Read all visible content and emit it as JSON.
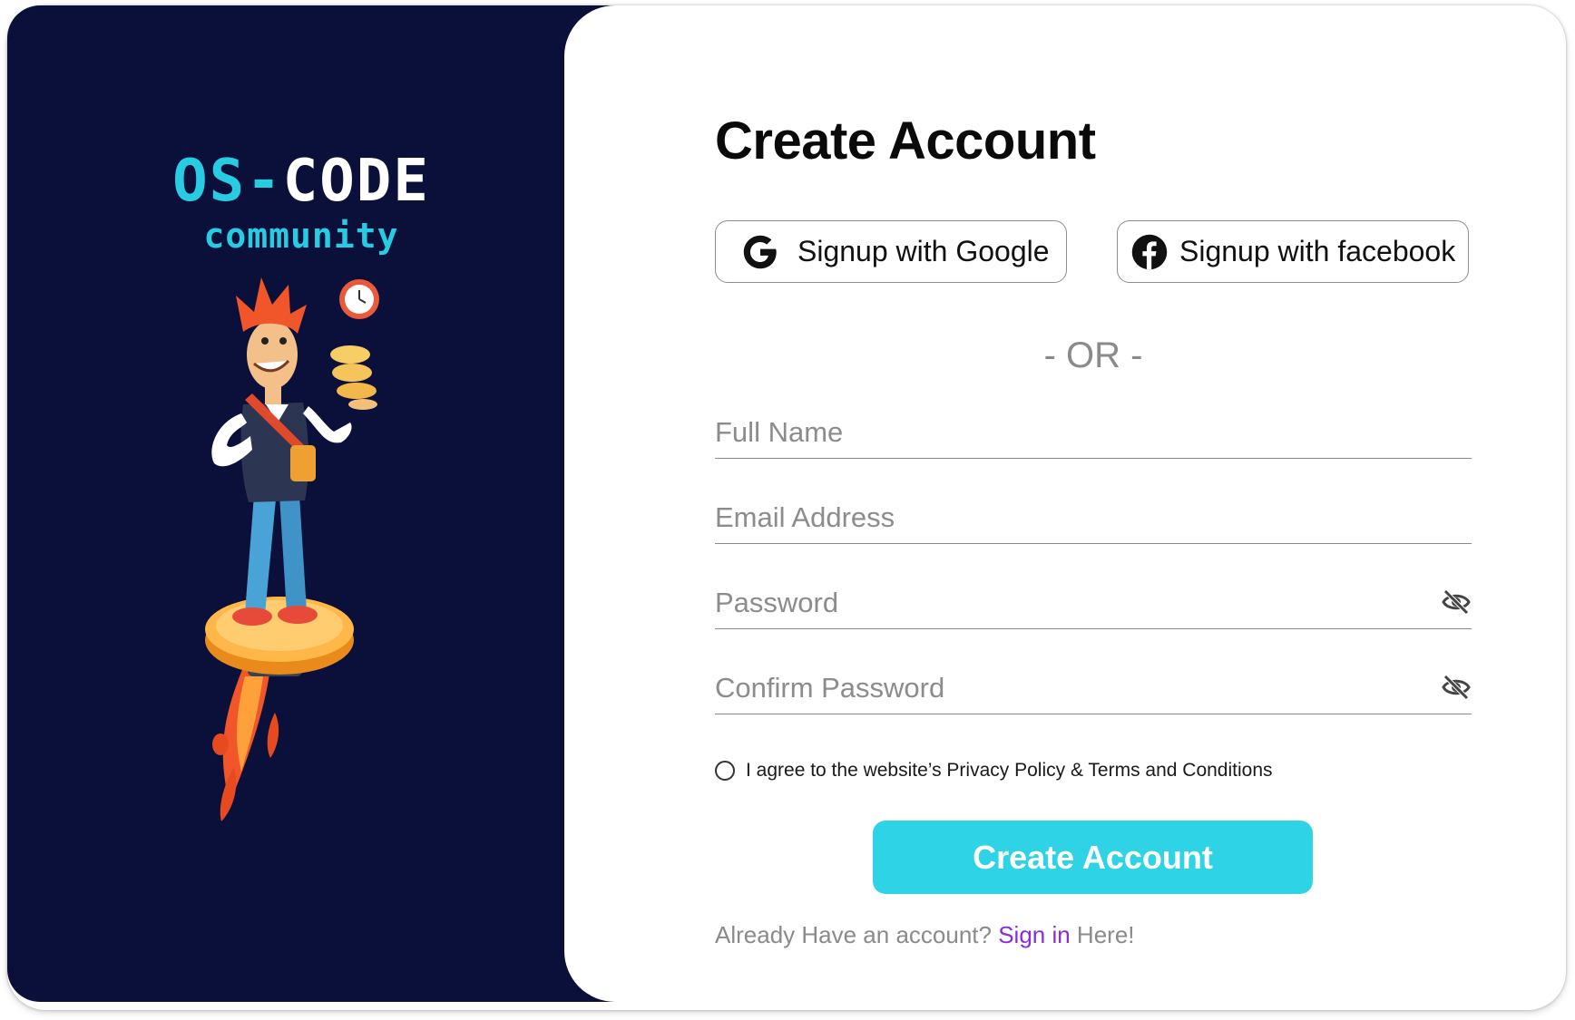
{
  "brand": {
    "logo_os": "OS-",
    "logo_code": "CODE",
    "logo_sub": "community"
  },
  "form": {
    "title": "Create Account",
    "google_label": "Signup with Google",
    "facebook_label": "Signup with facebook",
    "or_text": "- OR -",
    "fields": {
      "full_name_placeholder": "Full Name",
      "email_placeholder": "Email Address",
      "password_placeholder": "Password",
      "confirm_password_placeholder": "Confirm Password"
    },
    "agree_text": "I agree to the website’s Privacy Policy & Terms and Conditions",
    "submit_label": "Create Account",
    "signin_prefix": "Already Have an account? ",
    "signin_link": "Sign in",
    "signin_suffix": " Here!"
  },
  "colors": {
    "panel_bg": "#0b103a",
    "accent_cyan": "#2ed3e6",
    "link_purple": "#8a2be2"
  },
  "icons": [
    "google-icon",
    "facebook-icon",
    "eye-off-icon",
    "rocket-character-illustration"
  ]
}
